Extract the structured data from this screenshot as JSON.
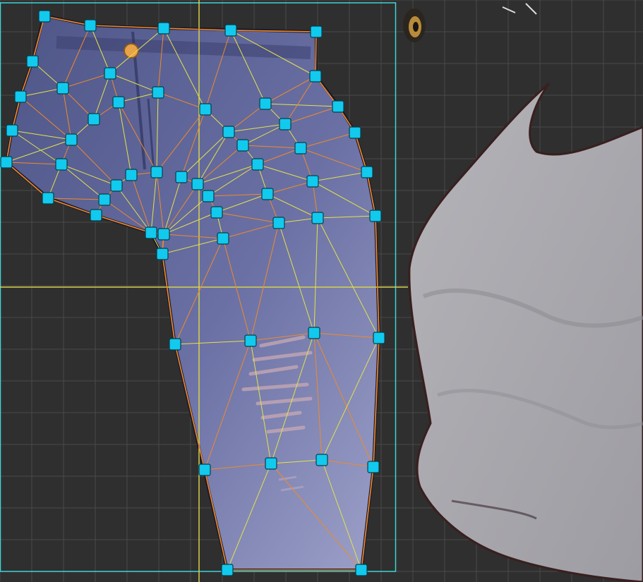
{
  "editor": {
    "mode": "mesh-deformer",
    "colors": {
      "background": "#2f2f2f",
      "grid": "#4a4a4a",
      "bounds": "#3fd6d6",
      "guide": "#d6d24a",
      "handle": "#12c9ee",
      "handle_stroke": "#0a3c4a",
      "edge_outer": "#f08a2a",
      "edge_inner": "#e3e34a",
      "jeans": "#5a6196",
      "jeans_light": "#8c92bf",
      "shirt": "#a9a8ad",
      "outline": "#2a1a1a"
    },
    "grid_spacing": 45
  },
  "layers": [
    {
      "name": "jeans-leg",
      "icon": "jeans-icon"
    },
    {
      "name": "shirt-body",
      "icon": "shirt-icon"
    },
    {
      "name": "eye",
      "icon": "eye-icon"
    }
  ]
}
